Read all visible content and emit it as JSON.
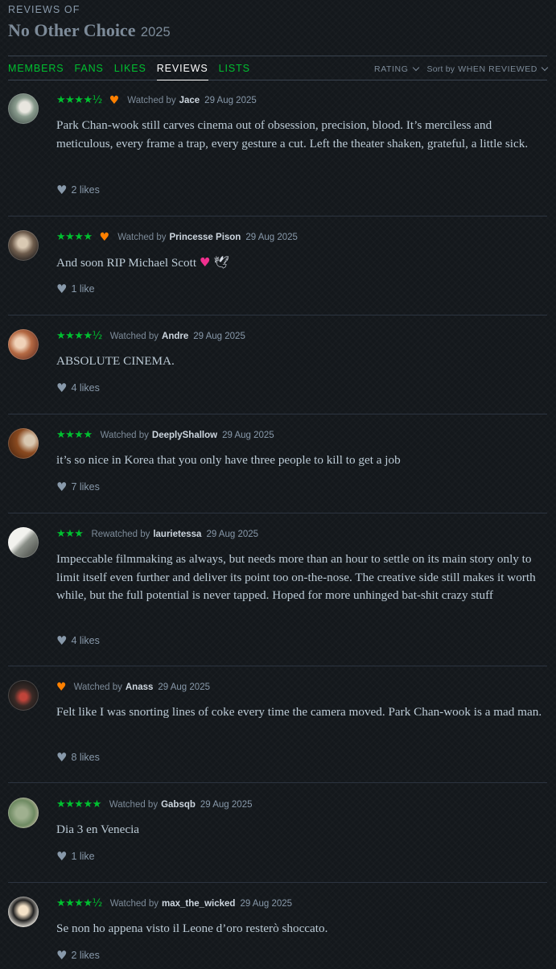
{
  "header": {
    "eyebrow": "REVIEWS OF",
    "film_title": "No Other Choice",
    "film_year": "2025"
  },
  "nav": {
    "tabs": [
      {
        "label": "MEMBERS",
        "active": false
      },
      {
        "label": "FANS",
        "active": false
      },
      {
        "label": "LIKES",
        "active": false
      },
      {
        "label": "REVIEWS",
        "active": true
      },
      {
        "label": "LISTS",
        "active": false
      }
    ],
    "rating_filter": "RATING",
    "sort_prefix": "Sort by",
    "sort_value": "WHEN REVIEWED"
  },
  "reviews": [
    {
      "stars": "★★★★½",
      "liked": true,
      "watch_type": "Watched by",
      "user": "Jace",
      "date": "29 Aug 2025",
      "text": "Park Chan-wook still carves cinema out of obsession, precision, blood. It’s merciless and meticulous, every frame a trap, every gesture a cut. Left the theater shaken, grateful, a little sick.",
      "likes": "2 likes"
    },
    {
      "stars": "★★★★",
      "liked": true,
      "watch_type": "Watched by",
      "user": "Princesse Pison",
      "date": "29 Aug 2025",
      "text": "And soon RIP Michael Scott",
      "emoji": [
        "heart-emoji",
        "dove-emoji"
      ],
      "likes": "1 like"
    },
    {
      "stars": "★★★★½",
      "liked": false,
      "watch_type": "Watched by",
      "user": "Andre",
      "date": "29 Aug 2025",
      "text": "ABSOLUTE CINEMA.",
      "likes": "4 likes"
    },
    {
      "stars": "★★★★",
      "liked": false,
      "watch_type": "Watched by",
      "user": "DeeplyShallow",
      "date": "29 Aug 2025",
      "text": "it’s so nice in Korea that you only have three people to kill to get a job",
      "likes": "7 likes"
    },
    {
      "stars": "★★★",
      "liked": false,
      "watch_type": "Rewatched by",
      "user": "laurietessa",
      "date": "29 Aug 2025",
      "text": "Impeccable filmmaking as always, but needs more than an hour to settle on its main story only to limit itself even further and deliver its point too on-the-nose. The creative side still makes it worth while, but the full potential is never tapped. Hoped for more unhinged bat-shit crazy stuff",
      "likes": "4 likes"
    },
    {
      "stars": "",
      "liked": true,
      "watch_type": "Watched by",
      "user": "Anass",
      "date": "29 Aug 2025",
      "text": "Felt like I was snorting lines of coke every time the camera moved. Park Chan-wook is a mad man.",
      "likes": "8 likes"
    },
    {
      "stars": "★★★★★",
      "liked": false,
      "watch_type": "Watched by",
      "user": "Gabsqb",
      "date": "29 Aug 2025",
      "text": "Dia 3 en Venecia",
      "likes": "1 like"
    },
    {
      "stars": "★★★★½",
      "liked": false,
      "watch_type": "Watched by",
      "user": "max_the_wicked",
      "date": "29 Aug 2025",
      "text": "Se non ho appena visto il Leone d’oro resterò shoccato.",
      "likes": "2 likes"
    }
  ],
  "colors": {
    "background": "#14181c",
    "green": "#00c030",
    "orange": "#ff8000",
    "text": "#bccbd6",
    "muted": "#8899aa"
  }
}
